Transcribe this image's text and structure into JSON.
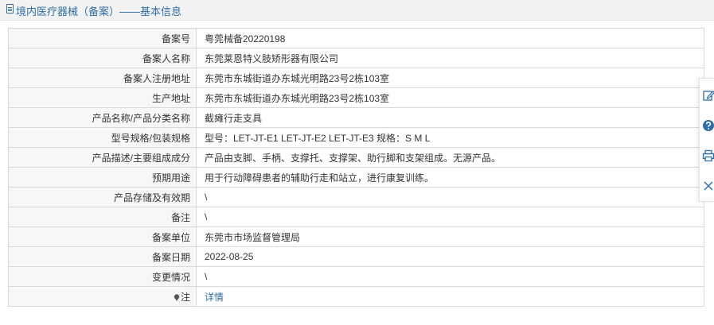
{
  "header": {
    "title": "境内医疗器械（备案）——基本信息",
    "icon": "document-icon",
    "accent_color": "#2e6ea6"
  },
  "rows": [
    {
      "label": "备案号",
      "value": "粤莞械备20220198"
    },
    {
      "label": "备案人名称",
      "value": "东莞莱恩特义肢矫形器有限公司"
    },
    {
      "label": "备案人注册地址",
      "value": "东莞市东城街道办东城光明路23号2栋103室"
    },
    {
      "label": "生产地址",
      "value": "东莞市东城街道办东城光明路23号2栋103室"
    },
    {
      "label": "产品名称/产品分类名称",
      "value": "截瘫行走支具"
    },
    {
      "label": "型号规格/包装规格",
      "value": "型号：LET-JT-E1 LET-JT-E2 LET-JT-E3 规格：S M L"
    },
    {
      "label": "产品描述/主要组成成分",
      "value": "产品由支脚、手柄、支撑托、支撑架、助行脚和支架组成。无源产品。"
    },
    {
      "label": "预期用途",
      "value": "用于行动障碍患者的辅助行走和站立，进行康复训练。"
    },
    {
      "label": "产品存储及有效期",
      "value": "\\"
    },
    {
      "label": "备注",
      "value": "\\"
    },
    {
      "label": "备案单位",
      "value": "东莞市市场监督管理局"
    },
    {
      "label": "备案日期",
      "value": "2022-08-25"
    },
    {
      "label": "变更情况",
      "value": "\\"
    },
    {
      "label": "注",
      "value": "详情"
    }
  ],
  "side_tools": [
    "edit-icon",
    "help-icon",
    "print-icon",
    "close-icon"
  ]
}
